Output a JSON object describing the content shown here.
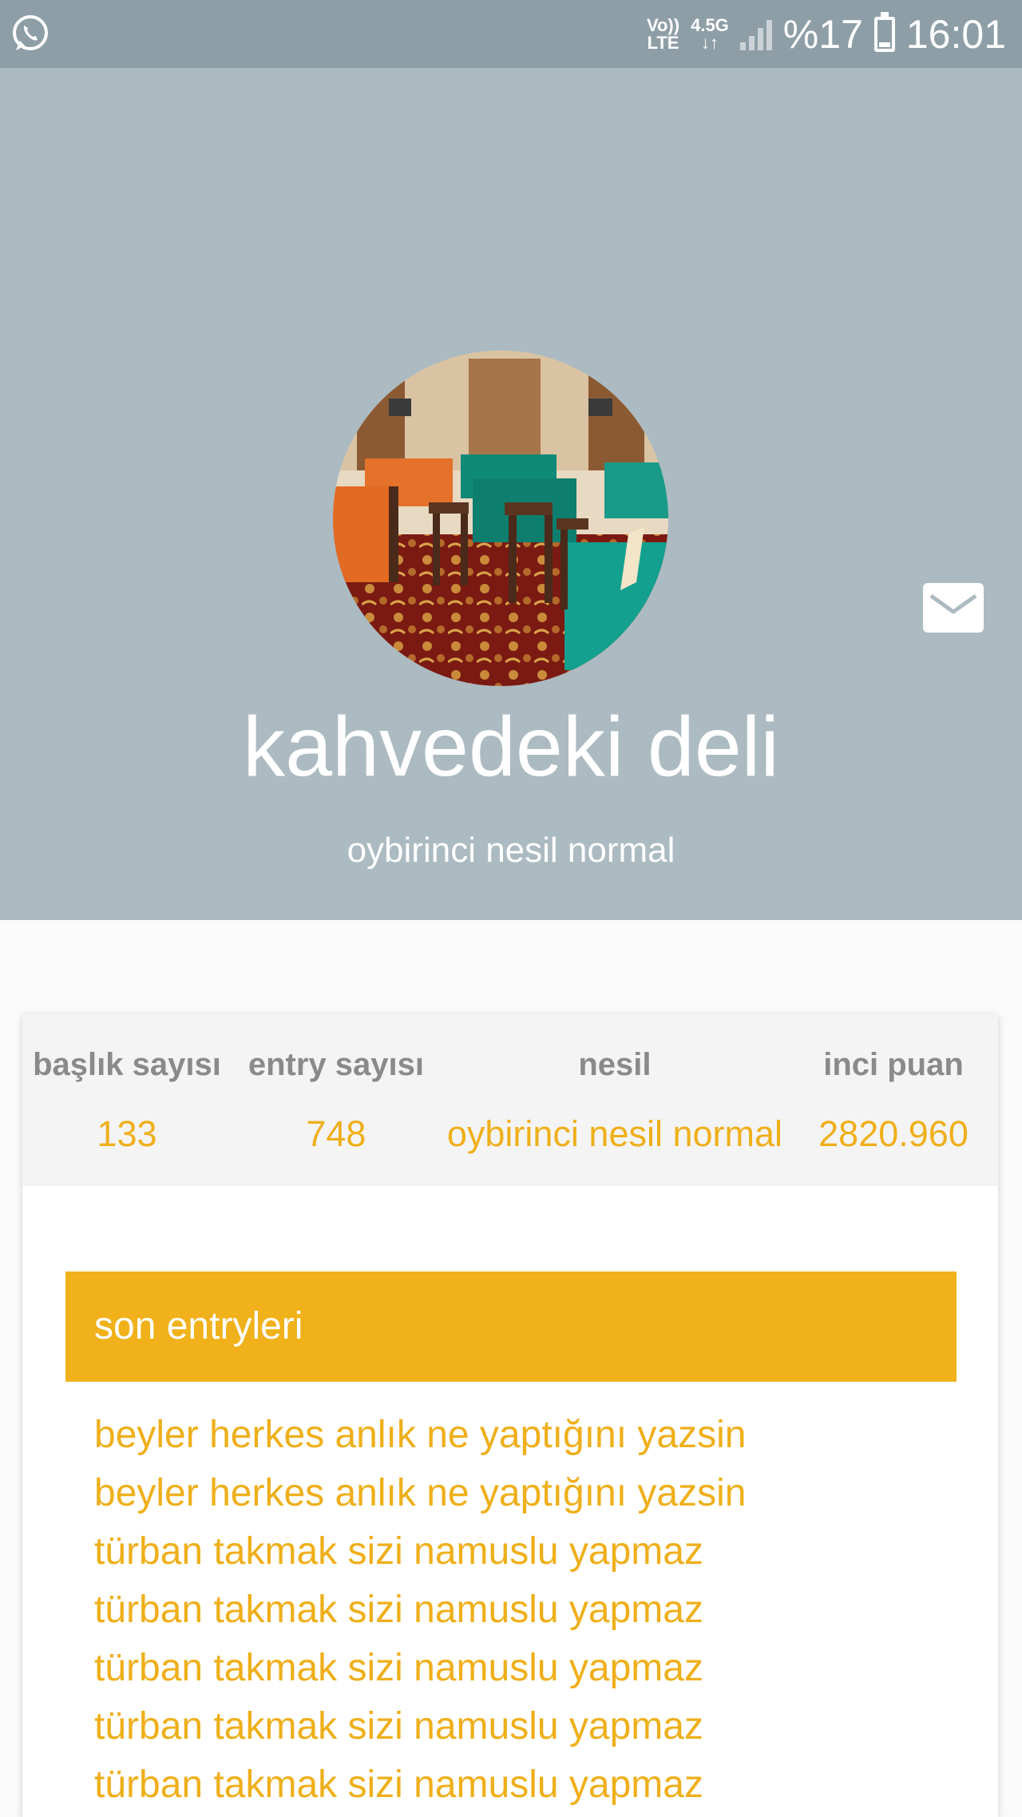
{
  "status_bar": {
    "app_icon": "whatsapp-icon",
    "volte_top": "Vo))",
    "volte_bottom": "LTE",
    "network_top": "4.5G",
    "network_bottom": "↓↑",
    "signal_icon": "signal-icon",
    "battery_percent": "%17",
    "battery_icon": "battery-icon",
    "time": "16:01"
  },
  "profile": {
    "avatar": "profile-photo-cafe",
    "username": "kahvedeki deli",
    "title": "oybirinci nesil normal",
    "message_icon": "mail-icon"
  },
  "stats": [
    {
      "label": "başlık sayısı",
      "value": "133"
    },
    {
      "label": "entry sayısı",
      "value": "748"
    },
    {
      "label": "nesil",
      "value": "oybirinci nesil normal"
    },
    {
      "label": "inci puan",
      "value": "2820.960"
    }
  ],
  "entries": {
    "header": "son entryleri",
    "items": [
      "beyler herkes anlık ne yaptığını yazsin",
      "beyler herkes anlık ne yaptığını yazsin",
      "türban takmak sizi namuslu yapmaz",
      "türban takmak sizi namuslu yapmaz",
      "türban takmak sizi namuslu yapmaz",
      "türban takmak sizi namuslu yapmaz",
      "türban takmak sizi namuslu yapmaz"
    ]
  },
  "colors": {
    "status_bar": "#8e9ea6",
    "header_bg": "#acbac1",
    "accent": "#f0b11a",
    "stat_label": "#8a8a8a"
  }
}
